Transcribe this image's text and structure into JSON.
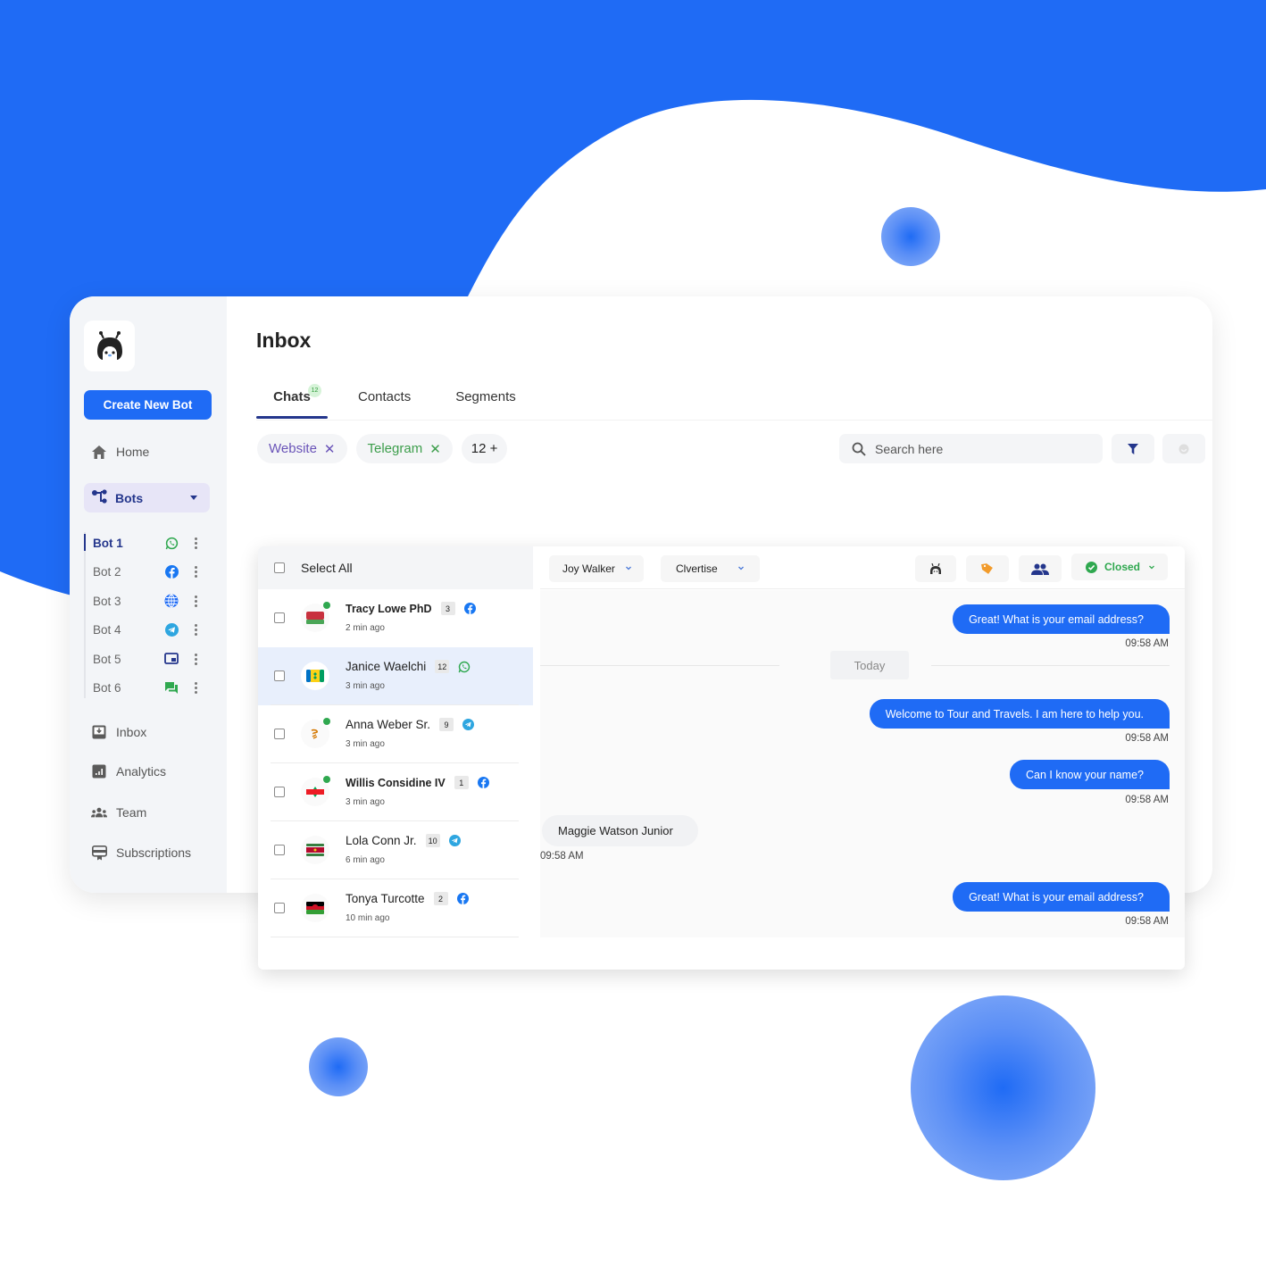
{
  "colors": {
    "brand_blue": "#1f6bf5",
    "navy": "#24368c",
    "green": "#2fa84f",
    "purple": "#6a54b8",
    "orange": "#f29b2b"
  },
  "sidebar": {
    "logo_icon": "bot-mascot-icon",
    "create_button": "Create New Bot",
    "home": {
      "label": "Home",
      "icon": "home-icon"
    },
    "bots": {
      "label": "Bots",
      "icon": "bots-network-icon",
      "expanded": true
    },
    "bot_list": [
      {
        "label": "Bot 1",
        "channel": "whatsapp",
        "active": true
      },
      {
        "label": "Bot 2",
        "channel": "facebook",
        "active": false
      },
      {
        "label": "Bot 3",
        "channel": "website",
        "active": false
      },
      {
        "label": "Bot 4",
        "channel": "telegram",
        "active": false
      },
      {
        "label": "Bot 5",
        "channel": "widget",
        "active": false
      },
      {
        "label": "Bot 6",
        "channel": "chat",
        "active": false
      }
    ],
    "nav": [
      {
        "label": "Inbox",
        "icon": "inbox-icon"
      },
      {
        "label": "Analytics",
        "icon": "analytics-icon"
      },
      {
        "label": "Team",
        "icon": "team-icon"
      },
      {
        "label": "Subscriptions",
        "icon": "subscriptions-icon"
      }
    ]
  },
  "header": {
    "title": "Inbox",
    "tabs": [
      {
        "label": "Chats",
        "badge": "12",
        "active": true
      },
      {
        "label": "Contacts",
        "active": false
      },
      {
        "label": "Segments",
        "active": false
      }
    ],
    "filters": [
      {
        "label": "Website",
        "removable": true
      },
      {
        "label": "Telegram",
        "removable": true
      },
      {
        "label": "12 +",
        "removable": false
      }
    ],
    "remove_glyph": "✕",
    "search": {
      "placeholder": "Search here",
      "value": ""
    }
  },
  "inbox": {
    "select_all": "Select All",
    "contacts": [
      {
        "name": "Tracy Lowe PhD",
        "count": "3",
        "channel": "facebook",
        "time": "2 min ago",
        "online": true,
        "bold": true,
        "selected": false,
        "flag": "belarus"
      },
      {
        "name": "Janice Waelchi",
        "count": "12",
        "channel": "whatsapp",
        "time": "3 min ago",
        "online": false,
        "bold": false,
        "selected": true,
        "flag": "saint-vincent"
      },
      {
        "name": "Anna Weber Sr.",
        "count": "9",
        "channel": "telegram",
        "time": "3 min ago",
        "online": true,
        "bold": false,
        "selected": false,
        "flag": "cyprus"
      },
      {
        "name": "Willis Considine IV",
        "count": "1",
        "channel": "facebook",
        "time": "3 min ago",
        "online": true,
        "bold": true,
        "selected": false,
        "flag": "lebanon"
      },
      {
        "name": "Lola Conn Jr.",
        "count": "10",
        "channel": "telegram",
        "time": "6 min ago",
        "online": false,
        "bold": false,
        "selected": false,
        "flag": "suriname"
      },
      {
        "name": "Tonya Turcotte",
        "count": "2",
        "channel": "facebook",
        "time": "10 min ago",
        "online": false,
        "bold": false,
        "selected": false,
        "flag": "malawi"
      }
    ]
  },
  "chat": {
    "agent_dropdown": "Joy Walker",
    "bot_dropdown": "Clvertise",
    "status": "Closed",
    "day_separator": "Today",
    "messages": [
      {
        "direction": "out",
        "text": "Great! What is your email address?",
        "time": "09:58 AM"
      },
      {
        "direction": "out",
        "text": "Welcome to Tour and Travels. I am here to help you.",
        "time": "09:58 AM"
      },
      {
        "direction": "out",
        "text": "Can I know your name?",
        "time": "09:58 AM"
      },
      {
        "direction": "in",
        "text": "Maggie Watson Junior",
        "time": "09:58 AM"
      },
      {
        "direction": "out",
        "text": "Great! What is your email address?",
        "time": "09:58 AM"
      }
    ]
  }
}
